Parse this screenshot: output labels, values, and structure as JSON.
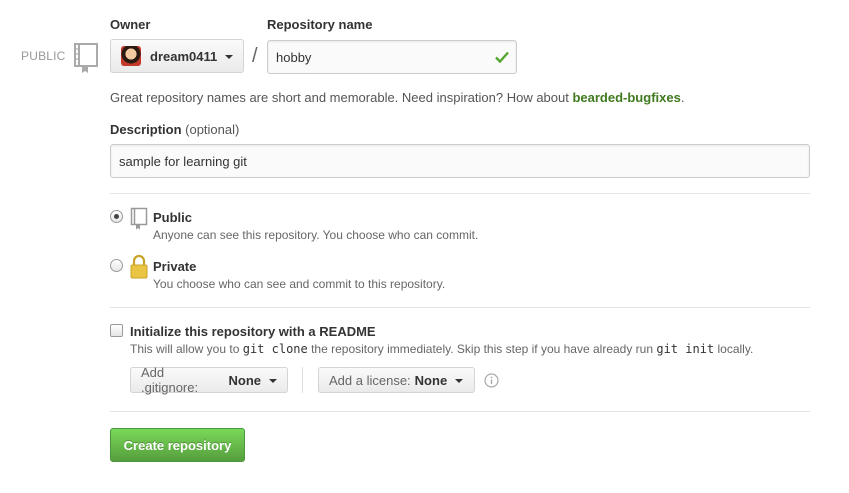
{
  "badge": {
    "public_label": "PUBLIC"
  },
  "owner": {
    "label": "Owner",
    "value": "dream0411"
  },
  "separator": "/",
  "repo_name": {
    "label": "Repository name",
    "value": "hobby"
  },
  "hint": {
    "prefix": "Great repository names are short and memorable. Need inspiration? How about ",
    "suggestion": "bearded-bugfixes",
    "suffix": "."
  },
  "description": {
    "label": "Description",
    "optional": "(optional)",
    "value": "sample for learning git"
  },
  "visibility": {
    "public": {
      "title": "Public",
      "desc": "Anyone can see this repository. You choose who can commit.",
      "checked": true
    },
    "private": {
      "title": "Private",
      "desc": "You choose who can see and commit to this repository.",
      "checked": false
    }
  },
  "readme": {
    "title": "Initialize this repository with a README",
    "desc_1": "This will allow you to ",
    "code_1": "git clone",
    "desc_2": " the repository immediately. Skip this step if you have already run ",
    "code_2": "git init",
    "desc_3": " locally."
  },
  "gitignore": {
    "label": "Add .gitignore:",
    "value": "None"
  },
  "license": {
    "label": "Add a license:",
    "value": "None"
  },
  "submit": {
    "label": "Create repository"
  },
  "colors": {
    "accent_green": "#569e3d",
    "suggestion_green": "#3f7a1f"
  },
  "icons": [
    "repo-icon",
    "avatar",
    "chevron-down-icon",
    "check-icon",
    "lock-icon",
    "info-icon"
  ]
}
